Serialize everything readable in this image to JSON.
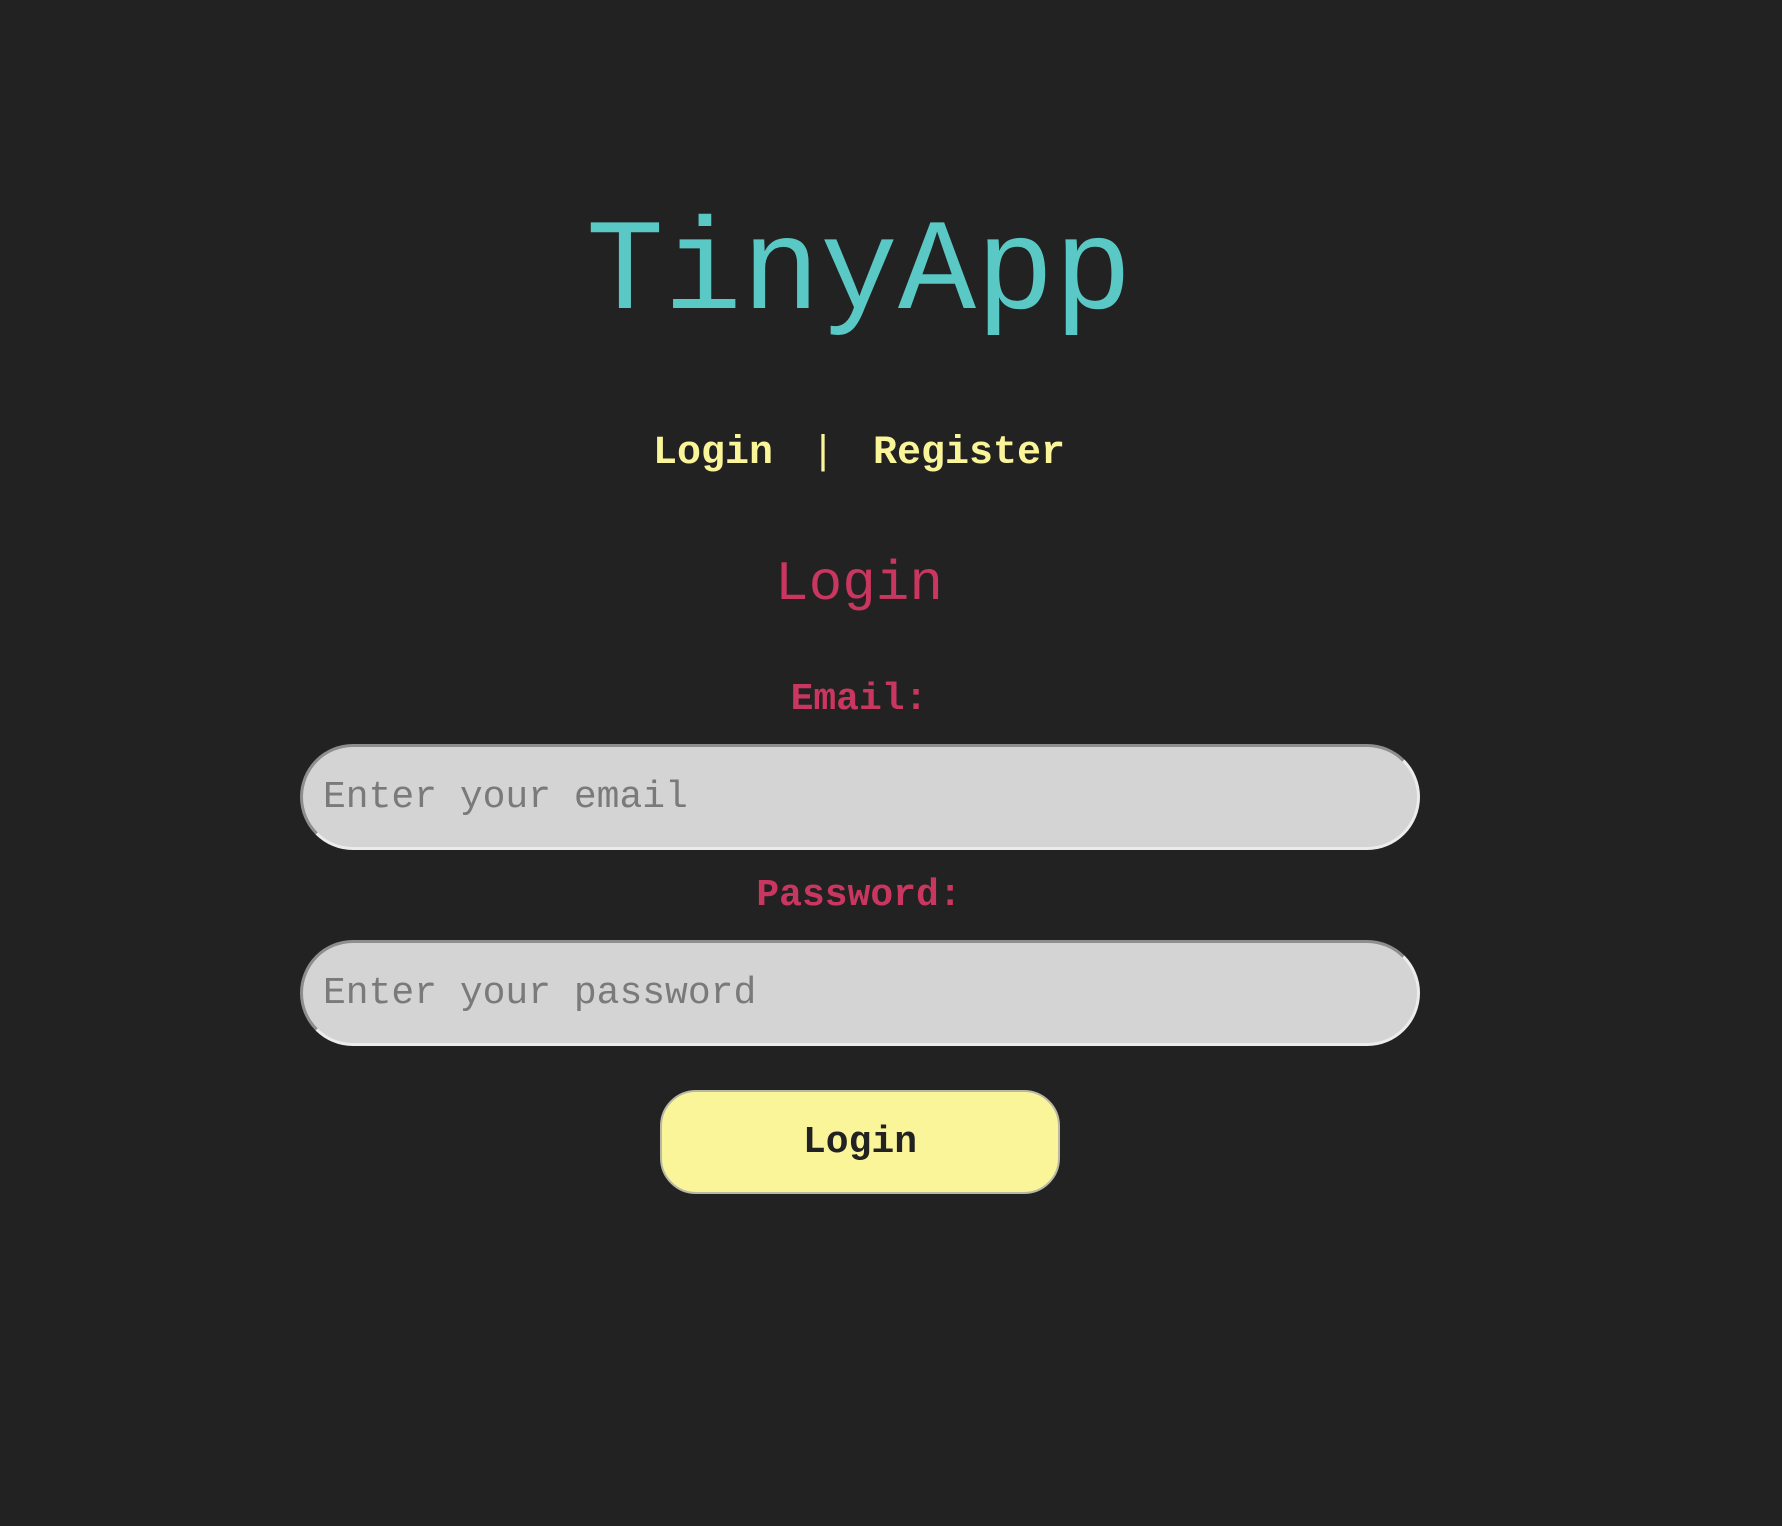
{
  "app": {
    "title": "TinyApp"
  },
  "nav": {
    "login_label": "Login",
    "separator": "|",
    "register_label": "Register"
  },
  "form": {
    "title": "Login",
    "email": {
      "label": "Email:",
      "placeholder": "Enter your email",
      "value": ""
    },
    "password": {
      "label": "Password:",
      "placeholder": "Enter your password",
      "value": ""
    },
    "submit_label": "Login"
  },
  "colors": {
    "background": "#222222",
    "title": "#5ac8c4",
    "nav_link": "#fbf59a",
    "form_heading": "#c9365f",
    "input_background": "#d4d4d4",
    "button_background": "#fbf59a"
  }
}
